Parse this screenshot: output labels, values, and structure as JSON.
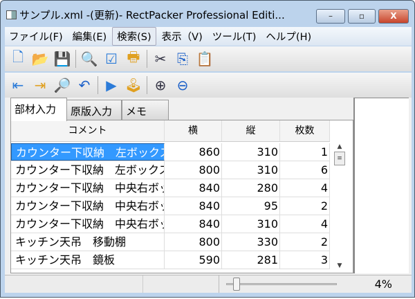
{
  "window": {
    "title": "サンプル.xml -(更新)- RectPacker Professional Editi...",
    "minimize": "–",
    "maximize": "▫",
    "close": "X"
  },
  "menu": [
    "ファイル(F)",
    "編集(E)",
    "検索(S)",
    "表示（V)",
    "ツール(T)",
    "ヘルプ(H)"
  ],
  "toolbar1": [
    {
      "name": "new-file-icon",
      "g": "🗋"
    },
    {
      "name": "open-folder-icon",
      "g": "📂"
    },
    {
      "name": "save-icon",
      "g": "💾"
    },
    {
      "name": "preview-icon",
      "g": "🔍"
    },
    {
      "name": "checklist-icon",
      "g": "☑"
    },
    {
      "name": "print-icon",
      "g": "🖶"
    },
    {
      "name": "cut-icon",
      "g": "✂"
    },
    {
      "name": "copy-icon",
      "g": "⎘"
    },
    {
      "name": "paste-icon",
      "g": "📋"
    }
  ],
  "toolbar2": [
    {
      "name": "align-left-icon",
      "g": "⇤"
    },
    {
      "name": "align-right-icon",
      "g": "⇥"
    },
    {
      "name": "search-icon",
      "g": "🔎"
    },
    {
      "name": "undo-icon",
      "g": "↶"
    },
    {
      "name": "play-icon",
      "g": "▶"
    },
    {
      "name": "joystick-icon",
      "g": "🕹"
    },
    {
      "name": "zoom-in-icon",
      "g": "⊕"
    },
    {
      "name": "zoom-out-icon",
      "g": "⊖"
    }
  ],
  "tabs": [
    "部材入力",
    "原版入力",
    "メモ"
  ],
  "columns": [
    "コメント",
    "横",
    "縦",
    "枚数"
  ],
  "rows": [
    [
      "カウンター下収納　左ボックス",
      "860",
      "310",
      "1"
    ],
    [
      "カウンター下収納　左ボックス",
      "800",
      "310",
      "6"
    ],
    [
      "カウンター下収納　中央右ボッ",
      "840",
      "280",
      "4"
    ],
    [
      "カウンター下収納　中央右ボッ",
      "840",
      "95",
      "2"
    ],
    [
      "カウンター下収納　中央右ボッ",
      "840",
      "310",
      "4"
    ],
    [
      "キッチン天吊　移動棚",
      "800",
      "330",
      "2"
    ],
    [
      "キッチン天吊　鏡板",
      "590",
      "281",
      "3"
    ]
  ],
  "status": {
    "zoom": "4%",
    "zoom_value": 4
  }
}
